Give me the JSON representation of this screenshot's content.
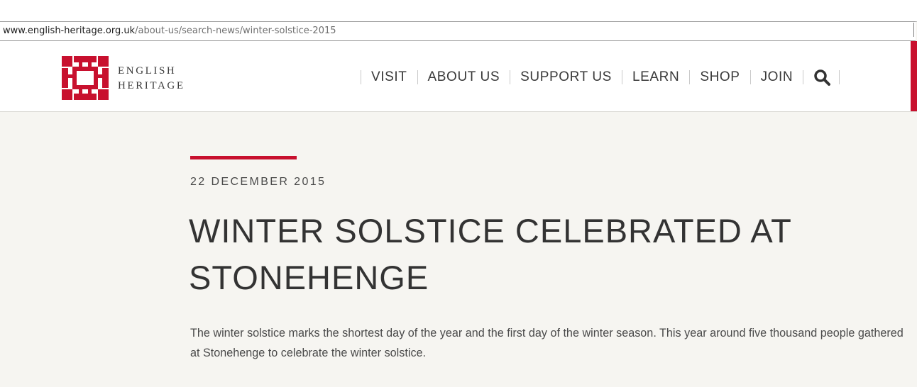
{
  "browser": {
    "url_domain": "www.english-heritage.org.uk",
    "url_path": "/about-us/search-news/winter-solstice-2015"
  },
  "header": {
    "brand_line1": "ENGLISH",
    "brand_line2": "HERITAGE",
    "logo_icon": "english-heritage-logo",
    "nav": [
      "VISIT",
      "ABOUT US",
      "SUPPORT US",
      "LEARN",
      "SHOP",
      "JOIN"
    ],
    "search_icon": "search-icon"
  },
  "article": {
    "date": "22 DECEMBER 2015",
    "title": "WINTER SOLSTICE CELEBRATED AT STONEHENGE",
    "body": "The winter solstice marks the shortest day of the year and the first day of the winter season. This year around five thousand people gathered at Stonehenge to celebrate the winter solstice."
  },
  "colors": {
    "accent": "#c8102e",
    "page_background": "#f6f5f1",
    "text": "#333333"
  }
}
